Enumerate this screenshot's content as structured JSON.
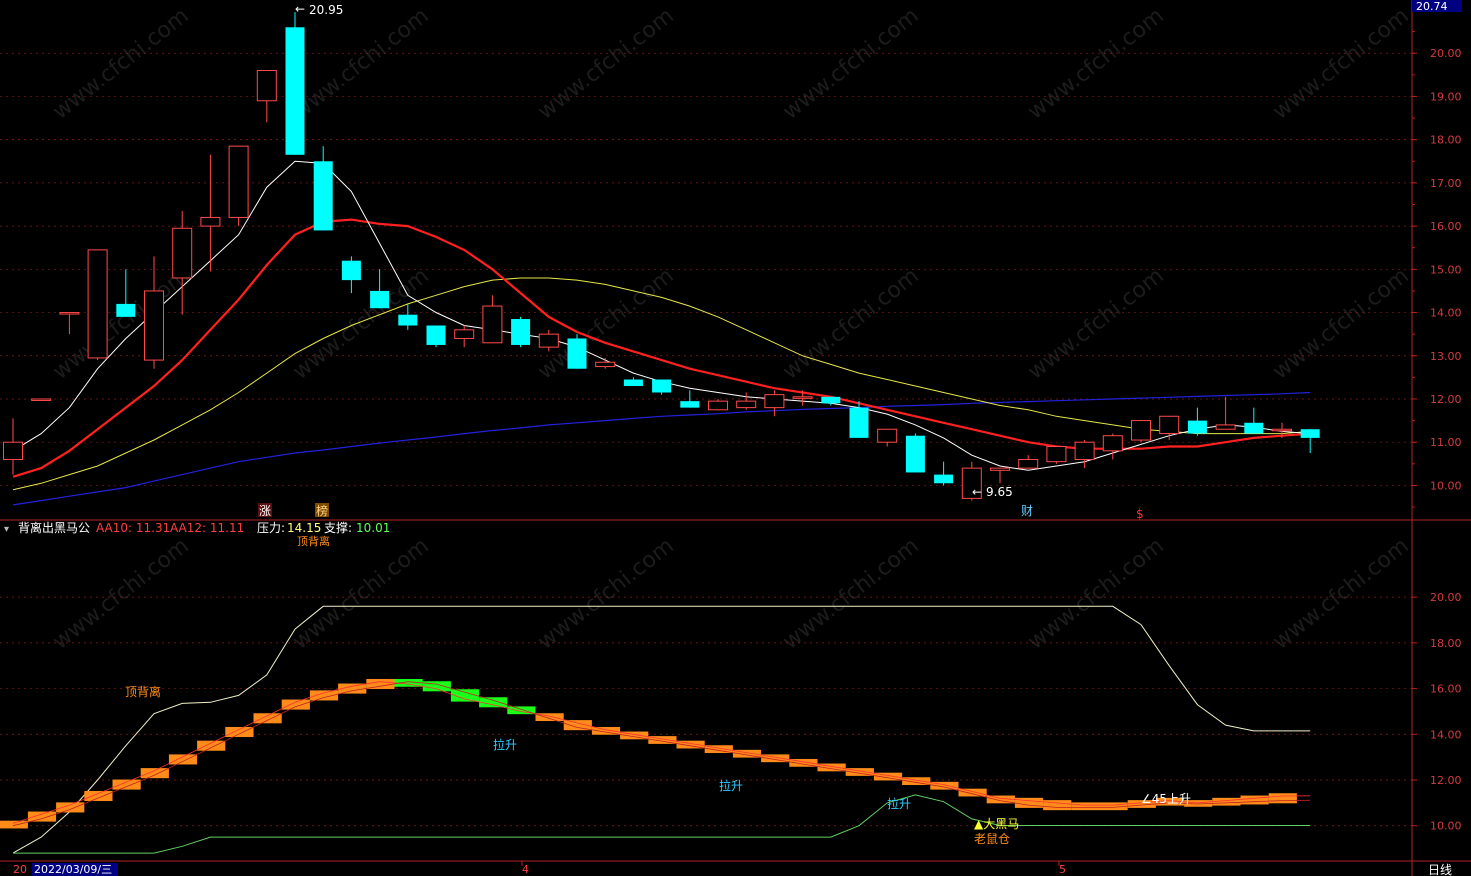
{
  "colors": {
    "background": "#000000",
    "frame": "#b22222",
    "grid": "#8b1a1a",
    "up": "#ff4a4a",
    "down": "#00ffff",
    "ma_white": "#ffffff",
    "ma_red": "#ff2020",
    "ma_yellow": "#e6e64a",
    "ma_blue": "#2222dd",
    "bull_band": "#ff8c1a",
    "bear_band": "#1aff1a",
    "support_line": "#60d060",
    "pressure_line": "#f0f0c8",
    "axis_text": "#d23c3c",
    "price_badge_bg": "#000080"
  },
  "main_panel": {
    "price_badge": "20.74",
    "high_label": "20.95",
    "low_label": "9.65",
    "event_labels": [
      "涨",
      "榜",
      "财",
      "$"
    ]
  },
  "indicator_header": {
    "name": "背离出黑马公",
    "aa10_label": "AA10: 11.31",
    "aa12_label": "AA12: 11.11",
    "pressure_label": "压力:",
    "pressure_value": "14.15",
    "support_label": "支撑:",
    "support_value": "10.01",
    "hidden_label": "顶背离"
  },
  "indicator_annotations": {
    "top_divergence": "顶背离",
    "pull_up_1": "拉升",
    "pull_up_2": "拉升",
    "pull_up_3": "拉升",
    "rise_45": "∠45上升",
    "dark_horse": "▲大黑马",
    "rat_warehouse": "老鼠仓"
  },
  "bottom_axis": {
    "date_prefix": "20",
    "date": "2022/03/09/三",
    "month_4": "4",
    "month_5": "5",
    "period": "日线"
  },
  "watermark": "www.cfchi.com",
  "chart_data": [
    {
      "type": "candlestick",
      "ylim": [
        9.2,
        21.0
      ],
      "yticks": [
        10.0,
        11.0,
        12.0,
        13.0,
        14.0,
        15.0,
        16.0,
        17.0,
        18.0,
        19.0,
        20.0
      ],
      "ohlc": [
        [
          10.6,
          11.55,
          10.25,
          11.0
        ],
        [
          12.0,
          12.0,
          12.0,
          12.0
        ],
        [
          14.0,
          14.0,
          13.5,
          14.0
        ],
        [
          12.95,
          15.45,
          12.9,
          15.45
        ],
        [
          14.2,
          15.0,
          13.9,
          13.9
        ],
        [
          12.9,
          15.3,
          12.7,
          14.5
        ],
        [
          14.8,
          16.35,
          13.95,
          15.95
        ],
        [
          16.0,
          17.65,
          14.95,
          16.2
        ],
        [
          16.2,
          17.85,
          16.0,
          17.85
        ],
        [
          18.9,
          19.6,
          18.4,
          19.6
        ],
        [
          20.6,
          20.95,
          17.65,
          17.65
        ],
        [
          17.5,
          17.85,
          15.9,
          15.9
        ],
        [
          15.2,
          15.3,
          14.45,
          14.75
        ],
        [
          14.5,
          15.0,
          14.1,
          14.1
        ],
        [
          13.95,
          14.2,
          13.6,
          13.7
        ],
        [
          13.7,
          13.7,
          13.2,
          13.25
        ],
        [
          13.4,
          13.7,
          13.2,
          13.6
        ],
        [
          13.3,
          14.4,
          13.3,
          14.15
        ],
        [
          13.85,
          13.9,
          13.2,
          13.25
        ],
        [
          13.2,
          13.6,
          13.1,
          13.5
        ],
        [
          13.4,
          13.5,
          12.7,
          12.7
        ],
        [
          12.75,
          12.95,
          12.7,
          12.85
        ],
        [
          12.45,
          12.5,
          12.3,
          12.3
        ],
        [
          12.45,
          12.45,
          12.1,
          12.15
        ],
        [
          11.95,
          12.2,
          11.8,
          11.8
        ],
        [
          11.75,
          12.0,
          11.8,
          11.95
        ],
        [
          11.8,
          12.15,
          11.75,
          11.95
        ],
        [
          11.8,
          12.2,
          11.6,
          12.1
        ],
        [
          12.05,
          12.2,
          11.85,
          12.05
        ],
        [
          12.05,
          12.0,
          11.85,
          11.9
        ],
        [
          11.8,
          11.95,
          11.2,
          11.1
        ],
        [
          11.0,
          11.3,
          10.9,
          11.3
        ],
        [
          11.15,
          11.2,
          10.3,
          10.3
        ],
        [
          10.25,
          10.55,
          10.0,
          10.05
        ],
        [
          9.7,
          10.55,
          9.65,
          10.4
        ],
        [
          10.35,
          10.35,
          10.05,
          10.4
        ],
        [
          10.4,
          10.7,
          10.4,
          10.6
        ],
        [
          10.55,
          10.9,
          10.5,
          10.9
        ],
        [
          10.6,
          11.05,
          10.4,
          11.0
        ],
        [
          10.8,
          11.2,
          10.6,
          11.15
        ],
        [
          11.05,
          11.5,
          11.0,
          11.5
        ],
        [
          11.2,
          11.6,
          11.05,
          11.6
        ],
        [
          11.5,
          11.8,
          11.15,
          11.2
        ],
        [
          11.3,
          12.05,
          11.3,
          11.4
        ],
        [
          11.45,
          11.8,
          11.2,
          11.2
        ],
        [
          11.3,
          11.45,
          11.1,
          11.3
        ],
        [
          11.3,
          11.3,
          10.75,
          11.1
        ]
      ],
      "ma_white": [
        10.8,
        11.2,
        11.8,
        12.7,
        13.4,
        14.0,
        14.6,
        15.2,
        15.8,
        16.9,
        17.5,
        17.45,
        16.8,
        15.6,
        14.4,
        14.0,
        13.7,
        13.6,
        13.5,
        13.4,
        13.2,
        12.9,
        12.6,
        12.4,
        12.25,
        12.15,
        12.05,
        12.0,
        11.95,
        11.9,
        11.8,
        11.65,
        11.4,
        11.1,
        10.7,
        10.45,
        10.35,
        10.45,
        10.55,
        10.75,
        10.95,
        11.15,
        11.3,
        11.4,
        11.35,
        11.25,
        11.2
      ],
      "ma_red": [
        10.2,
        10.4,
        10.8,
        11.3,
        11.8,
        12.3,
        12.9,
        13.6,
        14.3,
        15.1,
        15.8,
        16.1,
        16.15,
        16.05,
        16.0,
        15.75,
        15.45,
        15.0,
        14.45,
        13.9,
        13.55,
        13.3,
        13.1,
        12.9,
        12.7,
        12.55,
        12.4,
        12.25,
        12.15,
        12.05,
        11.9,
        11.75,
        11.6,
        11.45,
        11.3,
        11.15,
        11.0,
        10.9,
        10.85,
        10.85,
        10.85,
        10.9,
        10.9,
        11.0,
        11.1,
        11.15,
        11.2
      ],
      "ma_yellow": [
        9.9,
        10.05,
        10.25,
        10.45,
        10.75,
        11.05,
        11.4,
        11.75,
        12.15,
        12.6,
        13.05,
        13.4,
        13.7,
        13.95,
        14.2,
        14.4,
        14.6,
        14.75,
        14.8,
        14.8,
        14.75,
        14.65,
        14.5,
        14.35,
        14.15,
        13.9,
        13.6,
        13.3,
        13.0,
        12.8,
        12.6,
        12.45,
        12.3,
        12.15,
        12.0,
        11.85,
        11.75,
        11.6,
        11.5,
        11.4,
        11.3,
        11.25,
        11.2,
        11.2,
        11.2,
        11.2,
        11.25
      ],
      "ma_blue": [
        9.55,
        9.65,
        9.75,
        9.85,
        9.95,
        10.1,
        10.25,
        10.4,
        10.55,
        10.65,
        10.75,
        10.82,
        10.9,
        10.98,
        11.05,
        11.12,
        11.2,
        11.27,
        11.33,
        11.4,
        11.45,
        11.5,
        11.55,
        11.6,
        11.63,
        11.66,
        11.7,
        11.73,
        11.76,
        11.78,
        11.8,
        11.83,
        11.85,
        11.87,
        11.9,
        11.92,
        11.94,
        11.96,
        11.98,
        12.0,
        12.02,
        12.04,
        12.06,
        12.08,
        12.1,
        12.12,
        12.15
      ]
    },
    {
      "type": "line",
      "ylim": [
        8.5,
        22.5
      ],
      "yticks": [
        10.0,
        12.0,
        14.0,
        16.0,
        18.0,
        20.0
      ],
      "series": [
        {
          "name": "压力",
          "values": [
            8.8,
            9.5,
            10.6,
            12.0,
            13.5,
            14.9,
            15.35,
            15.4,
            15.7,
            16.6,
            18.6,
            19.6,
            19.6,
            19.6,
            19.6,
            19.6,
            19.6,
            19.6,
            19.6,
            19.6,
            19.6,
            19.6,
            19.6,
            19.6,
            19.6,
            19.6,
            19.6,
            19.6,
            19.6,
            19.6,
            19.6,
            19.6,
            19.6,
            19.6,
            19.6,
            19.6,
            19.6,
            19.6,
            19.6,
            19.6,
            18.8,
            17.0,
            15.3,
            14.4,
            14.15,
            14.15,
            14.15
          ]
        },
        {
          "name": "支撑",
          "values": [
            8.8,
            8.8,
            8.8,
            8.8,
            8.8,
            8.8,
            9.1,
            9.5,
            9.5,
            9.5,
            9.5,
            9.5,
            9.5,
            9.5,
            9.5,
            9.5,
            9.5,
            9.5,
            9.5,
            9.5,
            9.5,
            9.5,
            9.5,
            9.5,
            9.5,
            9.5,
            9.5,
            9.5,
            9.5,
            9.5,
            10.0,
            11.0,
            11.35,
            11.05,
            10.3,
            10.01,
            10.01,
            10.01,
            10.01,
            10.01,
            10.01,
            10.01,
            10.01,
            10.01,
            10.01,
            10.01,
            10.01
          ]
        },
        {
          "name": "AA10",
          "values": [
            10.1,
            10.5,
            10.9,
            11.4,
            11.9,
            12.4,
            13.0,
            13.6,
            14.2,
            14.8,
            15.4,
            15.8,
            16.1,
            16.3,
            16.2,
            16.0,
            15.55,
            15.3,
            15.0,
            14.8,
            14.5,
            14.2,
            14.0,
            13.8,
            13.6,
            13.4,
            13.2,
            13.0,
            12.8,
            12.6,
            12.4,
            12.2,
            12.0,
            11.8,
            11.5,
            11.2,
            11.1,
            11.0,
            10.9,
            10.9,
            11.0,
            11.1,
            11.0,
            11.1,
            11.2,
            11.3,
            11.31
          ]
        },
        {
          "name": "AA12",
          "values": [
            10.0,
            10.3,
            10.7,
            11.2,
            11.7,
            12.2,
            12.8,
            13.4,
            14.0,
            14.6,
            15.2,
            15.6,
            15.9,
            16.1,
            16.3,
            16.2,
            15.85,
            15.5,
            15.1,
            14.7,
            14.3,
            14.1,
            13.9,
            13.7,
            13.5,
            13.3,
            13.1,
            12.9,
            12.7,
            12.5,
            12.3,
            12.1,
            11.9,
            11.7,
            11.4,
            11.1,
            10.9,
            10.8,
            10.8,
            10.8,
            10.9,
            11.0,
            10.95,
            11.0,
            11.05,
            11.1,
            11.11
          ]
        }
      ]
    }
  ]
}
